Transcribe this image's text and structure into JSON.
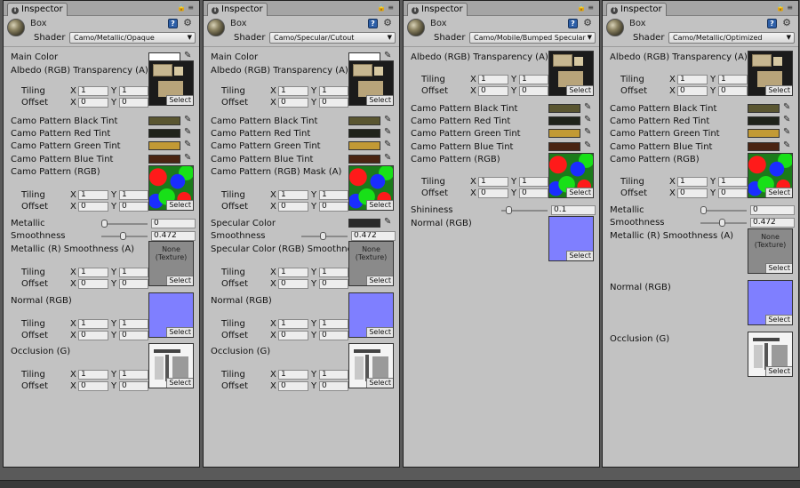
{
  "panels": [
    {
      "tab": "Inspector",
      "object_name": "Box",
      "shader_label": "Shader",
      "shader": "Camo/Metallic/Opaque",
      "main_color": {
        "label": "Main Color",
        "value": "#ffffff"
      },
      "albedo_label": "Albedo (RGB) Transparency (A)",
      "albedo_tiling": {
        "label": "Tiling",
        "x": "1",
        "y": "1"
      },
      "albedo_offset": {
        "label": "Offset",
        "x": "0",
        "y": "0"
      },
      "tints": [
        {
          "label": "Camo Pattern Black Tint",
          "color": "#5a5631"
        },
        {
          "label": "Camo Pattern Red Tint",
          "color": "#1f231a"
        },
        {
          "label": "Camo Pattern Green Tint",
          "color": "#c29a35"
        },
        {
          "label": "Camo Pattern Blue Tint",
          "color": "#4a2412"
        }
      ],
      "pattern_label": "Camo Pattern (RGB)",
      "pattern_tiling": {
        "label": "Tiling",
        "x": "1",
        "y": "1"
      },
      "pattern_offset": {
        "label": "Offset",
        "x": "0",
        "y": "0"
      },
      "slider1": {
        "label": "Metallic",
        "value": "0",
        "fraction": 0
      },
      "slider2": {
        "label": "Smoothness",
        "value": "0.472",
        "fraction": 0.472
      },
      "spec_tex_label": "Metallic (R) Smoothness (A)",
      "spec_tex_text": "None (Texture)",
      "spec_tiling": {
        "label": "Tiling",
        "x": "1",
        "y": "1"
      },
      "spec_offset": {
        "label": "Offset",
        "x": "0",
        "y": "0"
      },
      "normal_label": "Normal (RGB)",
      "normal_tiling": {
        "label": "Tiling",
        "x": "1",
        "y": "1"
      },
      "normal_offset": {
        "label": "Offset",
        "x": "0",
        "y": "0"
      },
      "occlusion_label": "Occlusion (G)",
      "occ_tiling": {
        "label": "Tiling",
        "x": "1",
        "y": "1"
      },
      "occ_offset": {
        "label": "Offset",
        "x": "0",
        "y": "0"
      }
    },
    {
      "tab": "Inspector",
      "object_name": "Box",
      "shader_label": "Shader",
      "shader": "Camo/Specular/Cutout",
      "main_color": {
        "label": "Main Color",
        "value": "#ffffff"
      },
      "albedo_label": "Albedo (RGB) Transparency (A)",
      "albedo_tiling": {
        "label": "Tiling",
        "x": "1",
        "y": "1"
      },
      "albedo_offset": {
        "label": "Offset",
        "x": "0",
        "y": "0"
      },
      "tints": [
        {
          "label": "Camo Pattern Black Tint",
          "color": "#5a5631"
        },
        {
          "label": "Camo Pattern Red Tint",
          "color": "#1f231a"
        },
        {
          "label": "Camo Pattern Green Tint",
          "color": "#c29a35"
        },
        {
          "label": "Camo Pattern Blue Tint",
          "color": "#4a2412"
        }
      ],
      "pattern_label": "Camo Pattern (RGB) Mask (A)",
      "pattern_tiling": {
        "label": "Tiling",
        "x": "1",
        "y": "1"
      },
      "pattern_offset": {
        "label": "Offset",
        "x": "0",
        "y": "0"
      },
      "specular_color": {
        "label": "Specular Color",
        "color": "#2a2a2a"
      },
      "slider2": {
        "label": "Smoothness",
        "value": "0.472",
        "fraction": 0.472
      },
      "spec_tex_label": "Specular Color (RGB) Smoothness (A)",
      "spec_tex_text": "None (Texture)",
      "spec_tiling": {
        "label": "Tiling",
        "x": "1",
        "y": "1"
      },
      "spec_offset": {
        "label": "Offset",
        "x": "0",
        "y": "0"
      },
      "normal_label": "Normal (RGB)",
      "normal_tiling": {
        "label": "Tiling",
        "x": "1",
        "y": "1"
      },
      "normal_offset": {
        "label": "Offset",
        "x": "0",
        "y": "0"
      },
      "occlusion_label": "Occlusion (G)",
      "occ_tiling": {
        "label": "Tiling",
        "x": "1",
        "y": "1"
      },
      "occ_offset": {
        "label": "Offset",
        "x": "0",
        "y": "0"
      }
    },
    {
      "tab": "Inspector",
      "object_name": "Box",
      "shader_label": "Shader",
      "shader": "Camo/Mobile/Bumped Specular",
      "albedo_label": "Albedo (RGB) Transparency (A)",
      "albedo_tiling": {
        "label": "Tiling",
        "x": "1",
        "y": "1"
      },
      "albedo_offset": {
        "label": "Offset",
        "x": "0",
        "y": "0"
      },
      "tints": [
        {
          "label": "Camo Pattern Black Tint",
          "color": "#5a5631"
        },
        {
          "label": "Camo Pattern Red Tint",
          "color": "#1f231a"
        },
        {
          "label": "Camo Pattern Green Tint",
          "color": "#c29a35"
        },
        {
          "label": "Camo Pattern Blue Tint",
          "color": "#4a2412"
        }
      ],
      "pattern_label": "Camo Pattern (RGB)",
      "pattern_tiling": {
        "label": "Tiling",
        "x": "1",
        "y": "1"
      },
      "pattern_offset": {
        "label": "Offset",
        "x": "0",
        "y": "0"
      },
      "shininess": {
        "label": "Shininess",
        "value": "0.1",
        "fraction": 0.1
      },
      "normal_label": "Normal (RGB)"
    },
    {
      "tab": "Inspector",
      "object_name": "Box",
      "shader_label": "Shader",
      "shader": "Camo/Metallic/Optimized",
      "albedo_label": "Albedo (RGB) Transparency (A)",
      "albedo_tiling": {
        "label": "Tiling",
        "x": "1",
        "y": "1"
      },
      "albedo_offset": {
        "label": "Offset",
        "x": "0",
        "y": "0"
      },
      "tints": [
        {
          "label": "Camo Pattern Black Tint",
          "color": "#5a5631"
        },
        {
          "label": "Camo Pattern Red Tint",
          "color": "#1f231a"
        },
        {
          "label": "Camo Pattern Green Tint",
          "color": "#c29a35"
        },
        {
          "label": "Camo Pattern Blue Tint",
          "color": "#4a2412"
        }
      ],
      "pattern_label": "Camo Pattern (RGB)",
      "pattern_tiling": {
        "label": "Tiling",
        "x": "1",
        "y": "1"
      },
      "pattern_offset": {
        "label": "Offset",
        "x": "0",
        "y": "0"
      },
      "slider1": {
        "label": "Metallic",
        "value": "0",
        "fraction": 0
      },
      "slider2": {
        "label": "Smoothness",
        "value": "0.472",
        "fraction": 0.472
      },
      "spec_tex_label": "Metallic (R) Smoothness (A)",
      "spec_tex_text": "None (Texture)",
      "normal_label": "Normal (RGB)",
      "occlusion_label": "Occlusion (G)"
    }
  ],
  "texture_button": "Select",
  "axis_x": "X",
  "axis_y": "Y",
  "icons": {
    "tab": "info-icon",
    "lock": "lock-icon",
    "menu": "context-menu-icon",
    "help": "help-book-icon",
    "gear": "gear-icon",
    "picker": "eyedropper-icon"
  }
}
